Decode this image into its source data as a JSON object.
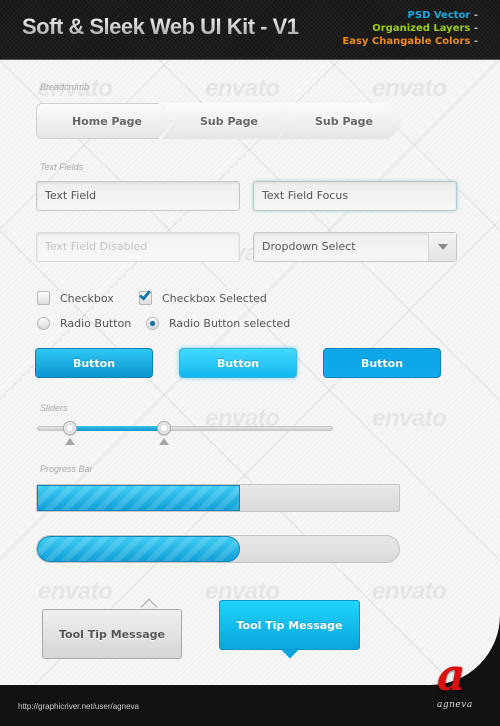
{
  "header": {
    "title": "Soft & Sleek Web UI Kit - V1",
    "features": [
      {
        "label": "PSD Vector",
        "color": "#1aa9e0"
      },
      {
        "label": "Organized Layers",
        "color": "#9ccc1a"
      },
      {
        "label": "Easy Changable Colors",
        "color": "#f08a1c"
      }
    ],
    "feature_suffix": " -"
  },
  "watermark": "envato",
  "sections": {
    "breadcrumb": "Breadcrumb",
    "text_fields": "Text Fields",
    "sliders": "Sliders",
    "progress_bar": "Progress Bar"
  },
  "breadcrumb": {
    "items": [
      "Home Page",
      "Sub Page",
      "Sub Page"
    ]
  },
  "text_fields": {
    "normal": "Text Field",
    "focus": "Text Field Focus",
    "disabled": "Text Field Disabled",
    "dropdown_selected": "Dropdown Select"
  },
  "checkboxes": [
    {
      "label": "Checkbox",
      "checked": false
    },
    {
      "label": "Checkbox Selected",
      "checked": true
    }
  ],
  "radios": [
    {
      "label": "Radio Button",
      "selected": false
    },
    {
      "label": "Radio Button selected",
      "selected": true
    }
  ],
  "buttons": [
    {
      "label": "Button",
      "state": "normal"
    },
    {
      "label": "Button",
      "state": "hover"
    },
    {
      "label": "Button",
      "state": "active"
    }
  ],
  "slider": {
    "range_start_pct": 11,
    "range_end_pct": 43
  },
  "progress_bars": [
    {
      "style": "square",
      "value_pct": 56
    },
    {
      "style": "rounded",
      "value_pct": 56
    }
  ],
  "tooltips": [
    {
      "label": "Tool Tip Message",
      "style": "grey",
      "arrow": "top"
    },
    {
      "label": "Tool Tip Message",
      "style": "blue",
      "arrow": "bottom"
    }
  ],
  "colors": {
    "accent": "#16b4e6",
    "accent_dark": "#0b95d1",
    "logo_red": "#d81010"
  },
  "footer": {
    "url": "http://graphicriver.net/user/agneva",
    "logo_letter": "a",
    "logo_name": "agneva"
  }
}
